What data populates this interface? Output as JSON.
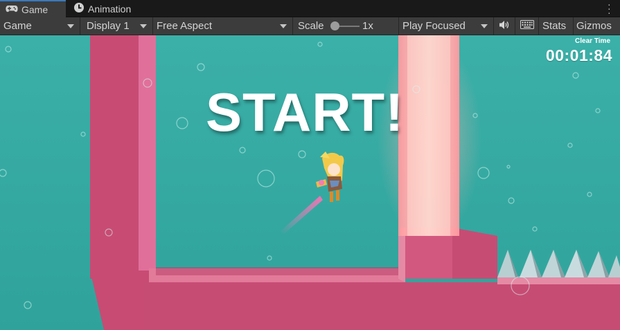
{
  "tabs": [
    {
      "label": "Game",
      "icon": "gamepad-icon",
      "active": true
    },
    {
      "label": "Animation",
      "icon": "animation-clock-icon",
      "active": false
    }
  ],
  "toolbar": {
    "game_mode": "Game",
    "display": "Display 1",
    "aspect": "Free Aspect",
    "scale_label": "Scale",
    "scale_value": "1x",
    "play_mode": "Play Focused",
    "stats": "Stats",
    "gizmos": "Gizmos"
  },
  "hud": {
    "clear_time_label": "Clear Time",
    "clear_time_value": "00:01:84"
  },
  "overlay": {
    "start_text": "START!"
  },
  "colors": {
    "tab_active_accent": "#3a79bb",
    "toolbar_bg": "#3c3c3c",
    "scene_background": "#36aaa3",
    "wall_pink": "#d0507a",
    "glow_beam": "#ffb6b0"
  }
}
